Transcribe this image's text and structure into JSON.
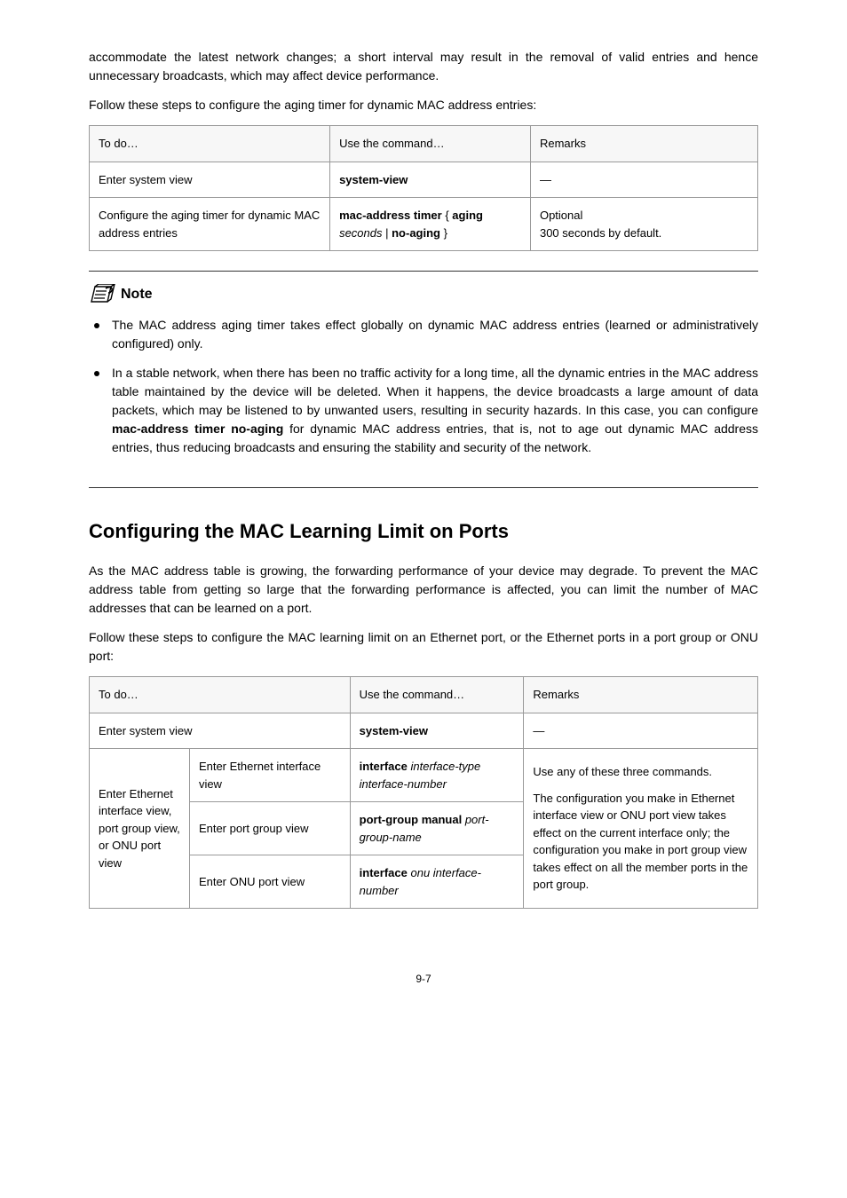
{
  "intro": {
    "p1": "accommodate the latest network changes; a short interval may result in the removal of valid entries and hence unnecessary broadcasts, which may affect device performance.",
    "p2": "Follow these steps to configure the aging timer for dynamic MAC address entries:"
  },
  "table1": {
    "headers": {
      "todo": "To do…",
      "cmd": "Use the command…",
      "rem": "Remarks"
    },
    "rows": [
      {
        "todo": "Enter system view",
        "cmd_kw": "system-view",
        "rem": "—"
      },
      {
        "todo": "Configure the aging timer for dynamic MAC address entries",
        "cmd_kw1": "mac-address timer",
        "cmd_brace1": " { ",
        "cmd_kw2": "aging",
        "cmd_sp": " ",
        "cmd_arg": "seconds",
        "cmd_pipe": " | ",
        "cmd_kw3": "no-aging",
        "cmd_brace2": " }",
        "rem_l1": "Optional",
        "rem_l2": "300 seconds by default."
      }
    ]
  },
  "note": {
    "label": "Note",
    "b1": "The MAC address aging timer takes effect globally on dynamic MAC address entries (learned or administratively configured) only.",
    "b2_pre": "In a stable network, when there has been no traffic activity for a long time, all the dynamic entries in the MAC address table maintained by the device will be deleted. When it happens, the device broadcasts a large amount of data packets, which may be listened to by unwanted users, resulting in security hazards. In this case, you can configure ",
    "b2_kw": "mac-address timer no-aging",
    "b2_post": " for dynamic MAC address entries, that is, not to age out dynamic MAC address entries, thus reducing broadcasts and ensuring the stability and security of the network."
  },
  "section": {
    "title": "Configuring the MAC Learning Limit on Ports",
    "p1": "As the MAC address table is growing, the forwarding performance of your device may degrade. To prevent the MAC address table from getting so large that the forwarding performance is affected, you can limit the number of MAC addresses that can be learned on a port.",
    "p2": "Follow these steps to configure the MAC learning limit on an Ethernet port, or the Ethernet ports in a port group or ONU port:"
  },
  "table2": {
    "headers": {
      "todo": "To do…",
      "cmd": "Use the command…",
      "rem": "Remarks"
    },
    "r1": {
      "todo": "Enter system view",
      "cmd_kw": "system-view",
      "rem": "—"
    },
    "group_left": "Enter Ethernet interface view, port group view, or ONU port view",
    "r2": {
      "todo": "Enter Ethernet interface view",
      "cmd_kw": "interface",
      "cmd_arg": "interface-type interface-number"
    },
    "r3": {
      "todo": "Enter port group view",
      "cmd_kw": "port-group manual",
      "cmd_arg": "port-group-name"
    },
    "r4": {
      "todo": "Enter ONU port view",
      "cmd_kw": "interface",
      "cmd_arg": "onu interface-number"
    },
    "rem_group_pre": "Use any of these three commands.",
    "rem_group_post": "The configuration you make in Ethernet interface view or ONU port view takes effect on the current interface only; the configuration you make in port group view takes effect on all the member ports in the port group."
  },
  "page_number": "9-7"
}
